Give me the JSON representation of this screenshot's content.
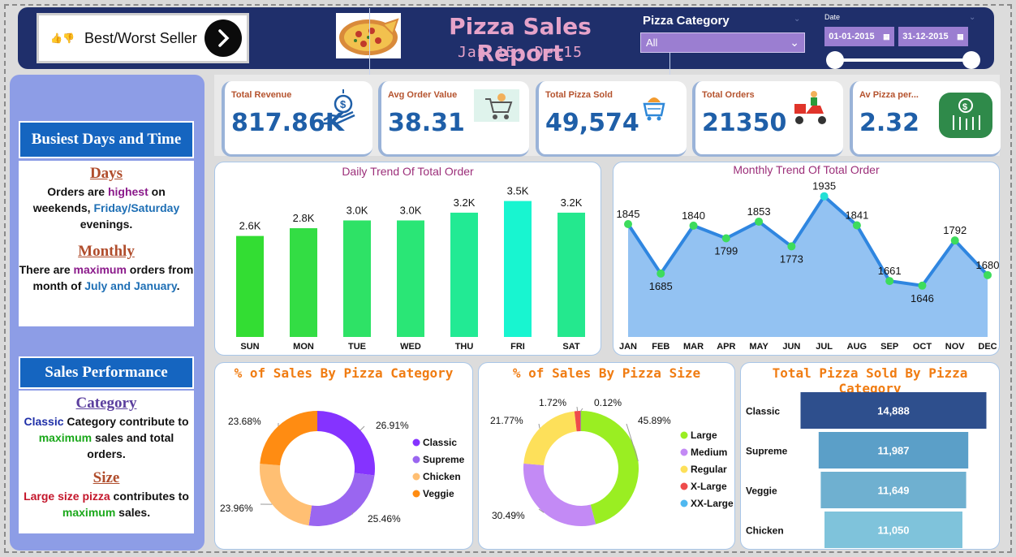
{
  "header": {
    "bw_button_label": "Best/Worst Seller",
    "title": "Pizza Sales Report",
    "subtitle": "Jan 15- Dec15",
    "category_filter": {
      "label": "Pizza Category",
      "selected": "All"
    },
    "date_filter": {
      "label": "Date",
      "start": "01-01-2015",
      "end": "31-12-2015"
    }
  },
  "left_panel": {
    "busiest": {
      "heading": "Busiest Days and Time",
      "days_title": "Days",
      "days_text": [
        "Orders are ",
        "highest",
        " on weekends, ",
        "Friday/Saturday",
        " evenings."
      ],
      "monthly_title": "Monthly",
      "monthly_text": [
        "There are ",
        "maximum",
        " orders from month of ",
        "July and January",
        "."
      ]
    },
    "sales": {
      "heading": "Sales Performance",
      "category_title": "Category",
      "category_text": [
        "Classic",
        " Category contribute to ",
        "maximum",
        " sales and total orders."
      ],
      "size_title": "Size",
      "size_text": [
        "Large size pizza",
        " contributes to ",
        "maximum",
        " sales."
      ]
    }
  },
  "kpis": [
    {
      "title": "Total Revenue",
      "value": "817.86K",
      "icon": "money-hand-icon"
    },
    {
      "title": "Avg Order Value",
      "value": "38.31",
      "icon": "shopping-cart-icon"
    },
    {
      "title": "Total Pizza Sold",
      "value": "49,574",
      "icon": "cart-pizza-icon"
    },
    {
      "title": "Total Orders",
      "value": "21350",
      "icon": "delivery-scooter-icon"
    },
    {
      "title": "Av Pizza per...",
      "value": "2.32",
      "icon": "money-growth-icon"
    }
  ],
  "chart_data": [
    {
      "type": "bar",
      "title": "Daily Trend Of Total Order",
      "categories": [
        "SUN",
        "MON",
        "TUE",
        "WED",
        "THU",
        "FRI",
        "SAT"
      ],
      "values": [
        2.6,
        2.8,
        3.0,
        3.0,
        3.2,
        3.5,
        3.2
      ],
      "labels": [
        "2.6K",
        "2.8K",
        "3.0K",
        "3.0K",
        "3.2K",
        "3.5K",
        "3.2K"
      ],
      "colors": [
        "#33dd33",
        "#33dd44",
        "#2ee266",
        "#2ae676",
        "#22ea94",
        "#18f5d0",
        "#24e88e"
      ],
      "ylim": [
        0,
        3.7
      ]
    },
    {
      "type": "area",
      "title": "Monthly Trend Of Total Order",
      "categories": [
        "JAN",
        "FEB",
        "MAR",
        "APR",
        "MAY",
        "JUN",
        "JUL",
        "AUG",
        "SEP",
        "OCT",
        "NOV",
        "DEC"
      ],
      "values": [
        1845,
        1685,
        1840,
        1799,
        1853,
        1773,
        1935,
        1841,
        1661,
        1646,
        1792,
        1680
      ],
      "ylim": [
        1480,
        1950
      ],
      "colors": {
        "line": "#2f86e0",
        "fill": "#93c2f2",
        "point": "#3ddc5c",
        "peak_point": "#22e0d6"
      }
    },
    {
      "type": "pie",
      "title": "% of Sales By Pizza Category",
      "categories": [
        "Classic",
        "Supreme",
        "Chicken",
        "Veggie"
      ],
      "values": [
        26.91,
        25.46,
        23.96,
        23.68
      ],
      "labels": [
        "26.91%",
        "25.46%",
        "23.96%",
        "23.68%"
      ],
      "colors": [
        "#8533ff",
        "#9a66f0",
        "#ffbf73",
        "#ff8c12"
      ]
    },
    {
      "type": "pie",
      "title": "% of Sales By Pizza Size",
      "categories": [
        "Large",
        "Medium",
        "Regular",
        "X-Large",
        "XX-Large"
      ],
      "values": [
        45.89,
        30.49,
        21.77,
        1.72,
        0.12
      ],
      "labels": [
        "45.89%",
        "30.49%",
        "21.77%",
        "1.72%",
        "0.12%"
      ],
      "colors": [
        "#9aee22",
        "#c38af5",
        "#fde05a",
        "#ee4b4b",
        "#4fb8f0"
      ]
    },
    {
      "type": "bar",
      "title": "Total Pizza Sold By Pizza Category",
      "categories": [
        "Classic",
        "Supreme",
        "Veggie",
        "Chicken"
      ],
      "values": [
        14888,
        11987,
        11649,
        11050
      ],
      "labels": [
        "14,888",
        "11,987",
        "11,649",
        "11,050"
      ],
      "colors": [
        "#2e4f8d",
        "#5b9fc8",
        "#6fb0d0",
        "#7fc3db"
      ]
    }
  ]
}
